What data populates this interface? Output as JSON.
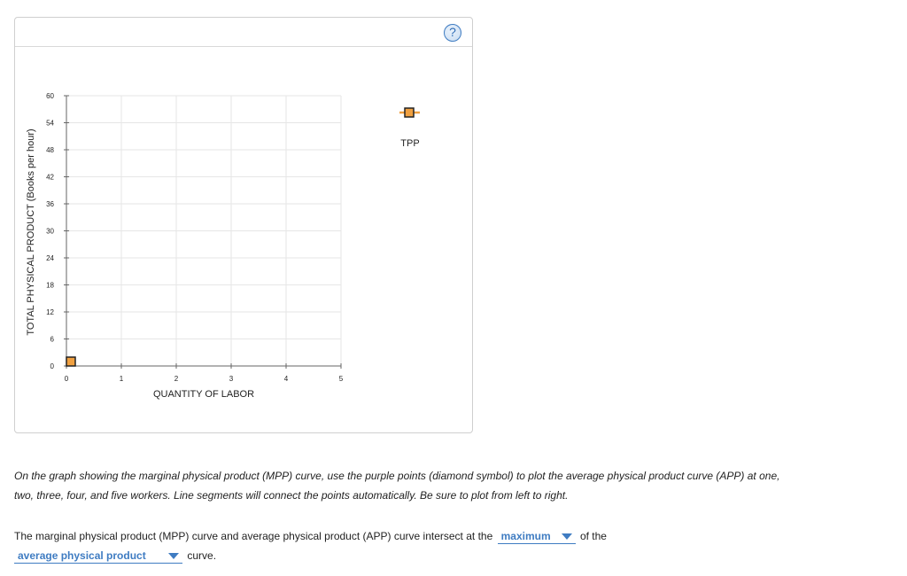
{
  "graph": {
    "y_axis_title": "TOTAL PHYSICAL PRODUCT (Books per hour)",
    "x_axis_title": "QUANTITY OF LABOR",
    "legend_label": "TPP",
    "help_symbol": "?"
  },
  "chart_data": {
    "type": "line",
    "xlabel": "QUANTITY OF LABOR",
    "ylabel": "TOTAL PHYSICAL PRODUCT (Books per hour)",
    "xlim": [
      0,
      5
    ],
    "ylim": [
      0,
      60
    ],
    "x_ticks": [
      "0",
      "1",
      "2",
      "3",
      "4",
      "5"
    ],
    "y_ticks": [
      "0",
      "6",
      "12",
      "18",
      "24",
      "30",
      "36",
      "42",
      "48",
      "54",
      "60"
    ],
    "grid": true,
    "legend_position": "top-right",
    "series": [
      {
        "name": "TPP",
        "color": "#f0a040",
        "marker": "square",
        "points": [
          [
            0,
            0
          ]
        ]
      }
    ]
  },
  "instructions": "On the graph showing the marginal physical product (MPP) curve, use the purple points (diamond symbol) to plot the average physical product curve (APP) at one, two, three, four, and five workers. Line segments will connect the points automatically. Be sure to plot from left to right.",
  "question": {
    "text_before": "The marginal physical product (MPP) curve and average physical product (APP) curve intersect at the",
    "dropdown_1": "maximum",
    "text_middle": "of the",
    "dropdown_2": "average physical product",
    "text_after": "curve."
  },
  "colors": {
    "accent": "#3f7cc2",
    "marker_fill": "#f0a040",
    "grid": "#e6e6e6"
  }
}
